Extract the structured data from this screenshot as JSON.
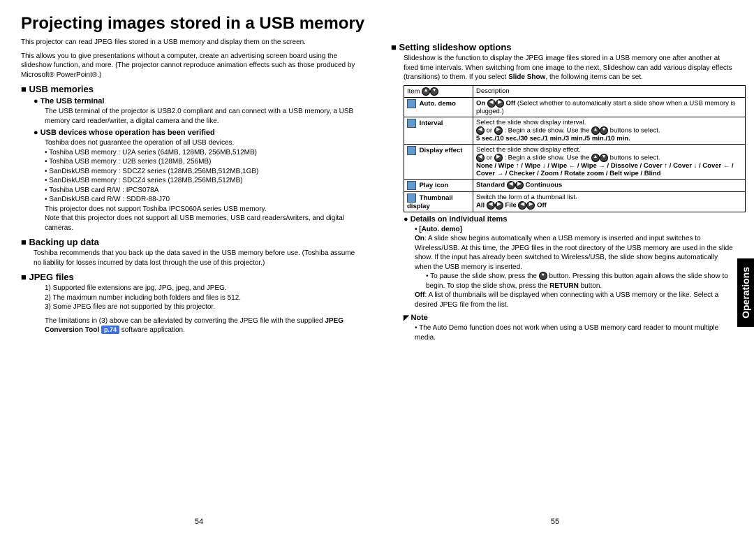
{
  "title": "Projecting images stored in a USB memory",
  "intro": {
    "p1": "This projector can read JPEG files stored in a USB memory and display them on the screen.",
    "p2": "This allows you to give presentations without a computer, create an advertising screen board using the slideshow function, and more. (The projector cannot reproduce animation effects such as those produced by Microsoft® PowerPoint®.)"
  },
  "usb_memories": {
    "heading": "USB memories",
    "terminal": {
      "heading": "The USB terminal",
      "text": "The USB terminal of the projector is USB2.0 compliant and can connect with a USB memory, a USB memory card reader/writer, a digital camera and the like."
    },
    "verified": {
      "heading": "USB devices whose operation has been verified",
      "lead": "Toshiba does not guarantee the operation of all USB devices.",
      "items": [
        "Toshiba USB memory    : U2A series (64MB, 128MB, 256MB,512MB)",
        "Toshiba USB memory    : U2B series (128MB, 256MB)",
        "SanDiskUSB memory  : SDCZ2 series (128MB,256MB,512MB,1GB)",
        "SanDiskUSB memory  : SDCZ4 series (128MB,256MB,512MB)",
        "Toshiba USB card R/W : IPCS078A",
        "SanDiskUSB card R/W : SDDR-88-J70"
      ],
      "trail1": "This projector does not support Toshiba IPCS060A series USB memory.",
      "trail2": "Note that this projector does not support all USB memories, USB card readers/writers, and digital cameras."
    }
  },
  "backing_up": {
    "heading": "Backing up data",
    "text": "Toshiba recommends that you back up the data saved in the USB memory before use. (Toshiba assume no liability for losses incurred by data lost through the use of this projector.)"
  },
  "jpeg": {
    "heading": "JPEG files",
    "items": [
      "1)  Supported file extensions are jpg, JPG, jpeg, and JPEG.",
      "2)  The maximum number including both folders and files is 512.",
      "3)  Some JPEG files are not supported by this projector."
    ],
    "trail_a": "The limitations in (3) above can be alleviated by converting the JPEG file with the supplied ",
    "trail_tool": "JPEG Conversion Tool",
    "trail_ref": "p.74",
    "trail_b": " software application."
  },
  "slideshow": {
    "heading": "Setting slideshow options",
    "intro_a": "Slideshow is the function to display the JPEG image files stored in a USB memory one after another at fixed time intervals. When switching from one image to the next, Slideshow can add various display effects (transitions) to them. If you select ",
    "intro_bold": "Slide Show",
    "intro_b": ", the following items can be set.",
    "table": {
      "head_item": "Item",
      "head_desc": "Description",
      "rows": [
        {
          "name": "Auto. demo",
          "desc_a": "On ",
          "desc_mid": " Off",
          "desc_b": "  (Select whether to automatically start a slide show when a USB memory is plugged.)"
        },
        {
          "name": "Interval",
          "desc_a": "Select the slide show display interval.",
          "desc_b": " or  : Begin a slide show. Use the   buttons to select.",
          "desc_bold": "5 sec./10 sec./30 sec./1 min./3 min./5 min./10 min."
        },
        {
          "name": "Display effect",
          "desc_a": "Select the slide show display effect.",
          "desc_b": " or  : Begin a slide show. Use the   buttons to select.",
          "desc_bold": "None / Wipe ↑ / Wipe ↓ / Wipe ← / Wipe → /  Dissolve / Cover ↑ / Cover ↓ / Cover ← / Cover → /  Checker / Zoom / Rotate zoom / Belt wipe / Blind"
        },
        {
          "name": "Play icon",
          "desc_bold": "Standard   Continuous"
        },
        {
          "name": "Thumbnail display",
          "desc_a": "Switch the form of a thumbnail list.",
          "desc_bold": "All   File   Off"
        }
      ]
    },
    "details_heading": "Details on individual items",
    "auto_demo": {
      "label": "[Auto. demo]",
      "on_label": "On",
      "on_text": ":  A slide show begins automatically when a USB memory is inserted and input switches to Wireless/USB. At this time, the JPEG files in the root directory of the USB memory are used in the slide show. If the input has already been switched to Wireless/USB, the slide show begins automatically when the USB memory is inserted.",
      "pause_a": "To pause the slide show, press the ",
      "pause_b": " button. Pressing this button again allows the slide show to begin. To stop the slide show, press the ",
      "return": "RETURN",
      "pause_c": " button.",
      "off_label": "Off",
      "off_text": ":  A list of thumbnails will be displayed when connecting with a USB memory or the like. Select a desired JPEG file from the list."
    },
    "note_heading": "Note",
    "note_text": "The Auto Demo function does not work when using a USB memory card reader to mount multiple media."
  },
  "side_tab": "Operations",
  "page_left": "54",
  "page_right": "55"
}
